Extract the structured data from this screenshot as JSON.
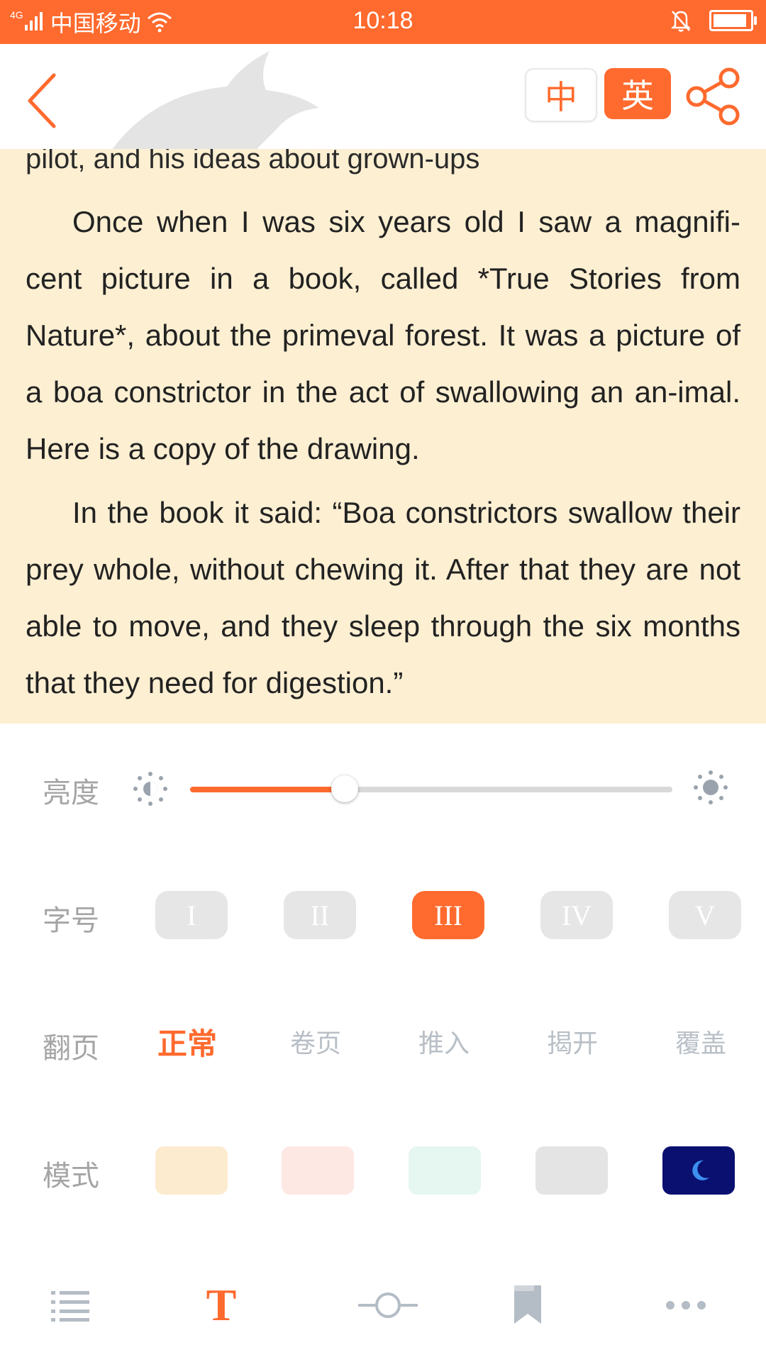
{
  "status_bar": {
    "network": "4G",
    "carrier": "中国移动",
    "time": "10:18"
  },
  "top_bar": {
    "lang_cn": "中",
    "lang_en": "英",
    "active_lang": "英"
  },
  "reader": {
    "chapter_line": "pilot, and his ideas about grown-ups",
    "paragraphs": [
      "Once when I was six years old I saw a magnifi-cent picture in a book, called *True Stories from Nature*, about the primeval forest. It was a picture of a boa constrictor in the act of swallowing an an-imal. Here is a copy of the drawing.",
      "In the book it said: “Boa constrictors swallow their prey whole, without chewing it. After that they are not able to move, and they sleep through the six months that they need for digestion.”"
    ]
  },
  "settings": {
    "brightness": {
      "label": "亮度",
      "value": 0.32
    },
    "font_size": {
      "label": "字号",
      "options": [
        "I",
        "II",
        "III",
        "IV",
        "V"
      ],
      "selected": "III"
    },
    "page_flip": {
      "label": "翻页",
      "options": [
        "正常",
        "卷页",
        "推入",
        "揭开",
        "覆盖"
      ],
      "selected": "正常"
    },
    "mode": {
      "label": "模式",
      "options": [
        {
          "name": "cream",
          "color": "#FDEBCF"
        },
        {
          "name": "pink",
          "color": "#FDE8E4"
        },
        {
          "name": "mint",
          "color": "#E6F6F1"
        },
        {
          "name": "gray",
          "color": "#E4E4E4"
        },
        {
          "name": "night",
          "color": "#0A1070",
          "icon": "moon-icon"
        }
      ]
    }
  },
  "toolbar": {
    "items": [
      "list-icon",
      "font-T-icon",
      "progress-icon",
      "bookmark-icon",
      "more-icon"
    ],
    "font_glyph": "T",
    "active": "font-T-icon"
  },
  "colors": {
    "accent": "#FF6A2E",
    "reader_bg": "#FDEFD2"
  }
}
